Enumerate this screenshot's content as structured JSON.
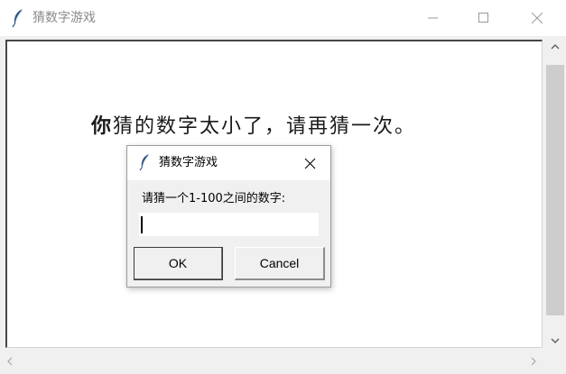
{
  "window": {
    "title": "猜数字游戏",
    "minimize_icon": "minimize-icon",
    "maximize_icon": "maximize-icon",
    "close_icon": "close-icon"
  },
  "main": {
    "message_bold": "你",
    "message_rest": "猜的数字太小了，请再猜一次。"
  },
  "dialog": {
    "title": "猜数字游戏",
    "prompt": "请猜一个1-100之间的数字:",
    "input_value": "",
    "ok_label": "OK",
    "cancel_label": "Cancel"
  },
  "colors": {
    "title_text": "#8a8a8a",
    "scroll_thumb": "#cdcdcd",
    "background": "#f0f0f0"
  }
}
